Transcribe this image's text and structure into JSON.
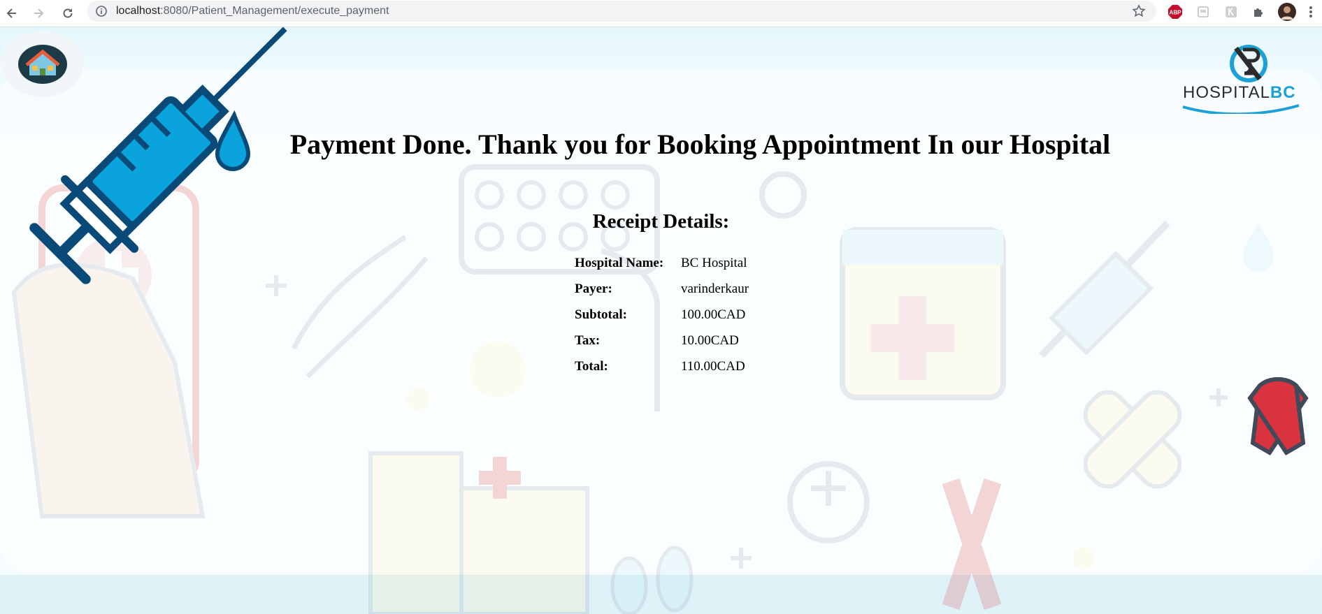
{
  "browser": {
    "url_host": "localhost",
    "url_rest": ":8080/Patient_Management/execute_payment",
    "abp_label": "ABP"
  },
  "site": {
    "logo_text_main": "HOSPITAL",
    "logo_text_accent": "BC",
    "logo_icon": "bc-hospital-logo-icon",
    "home_icon": "house-icon"
  },
  "main": {
    "headline": "Payment Done. Thank you for Booking Appointment In our Hospital",
    "receipt_title": "Receipt Details:",
    "receipt_rows": [
      {
        "label": "Hospital Name:",
        "value": "BC Hospital"
      },
      {
        "label": "Payer:",
        "value": "varinderkaur"
      },
      {
        "label": "Subtotal:",
        "value": "100.00CAD"
      },
      {
        "label": "Tax:",
        "value": "10.00CAD"
      },
      {
        "label": "Total:",
        "value": "110.00CAD"
      }
    ]
  },
  "colors": {
    "syringe": "#0a4a78",
    "syringe_fill": "#0ba3dc",
    "ribbon": "#d8333f",
    "logo_accent": "#1ba1d6"
  }
}
